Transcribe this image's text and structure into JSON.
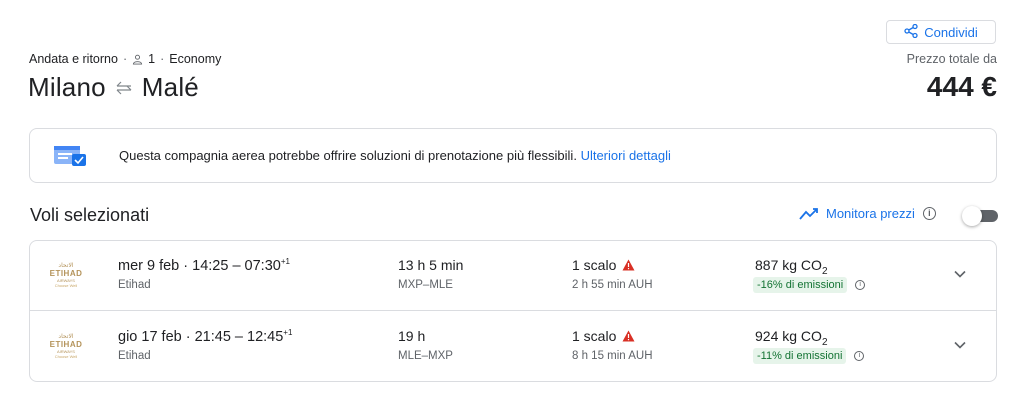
{
  "share": {
    "label": "Condividi"
  },
  "trip": {
    "type": "Andata e ritorno",
    "passengers": "1",
    "cabin": "Economy",
    "origin": "Milano",
    "destination": "Malé"
  },
  "price": {
    "label": "Prezzo totale da",
    "value": "444 €"
  },
  "banner": {
    "text": "Questa compagnia aerea potrebbe offrire soluzioni di prenotazione più flessibili.",
    "link": "Ulteriori dettagli"
  },
  "selected": {
    "title": "Voli selezionati",
    "monitor_label": "Monitora prezzi",
    "monitor_enabled": false
  },
  "flights": [
    {
      "date": "mer 9 feb",
      "times": "14:25 – 07:30",
      "day_offset": "+1",
      "airline": "Etihad",
      "duration": "13 h 5 min",
      "route": "MXP–MLE",
      "stops": "1 scalo",
      "layover": "2 h 55 min AUH",
      "co2_value": "887 kg CO",
      "co2_sub": "2",
      "emissions": "-16% di emissioni"
    },
    {
      "date": "gio 17 feb",
      "times": "21:45 – 12:45",
      "day_offset": "+1",
      "airline": "Etihad",
      "duration": "19 h",
      "route": "MLE–MXP",
      "stops": "1 scalo",
      "layover": "8 h 15 min AUH",
      "co2_value": "924 kg CO",
      "co2_sub": "2",
      "emissions": "-11% di emissioni"
    }
  ],
  "logo": {
    "arabic": "الاتحاد",
    "name": "ETIHAD",
    "sub": "AIRWAYS",
    "tag": "Choose Well"
  },
  "colors": {
    "accent": "#1a73e8",
    "warning": "#d93025",
    "eco_bg": "#e6f4ea",
    "eco_text": "#137333",
    "logo_gold": "#b4935a"
  },
  "icons": [
    "share-icon",
    "person-icon",
    "swap-arrows-icon",
    "booking-info-icon",
    "trend-icon",
    "info-icon",
    "warning-icon",
    "chevron-down-icon"
  ]
}
